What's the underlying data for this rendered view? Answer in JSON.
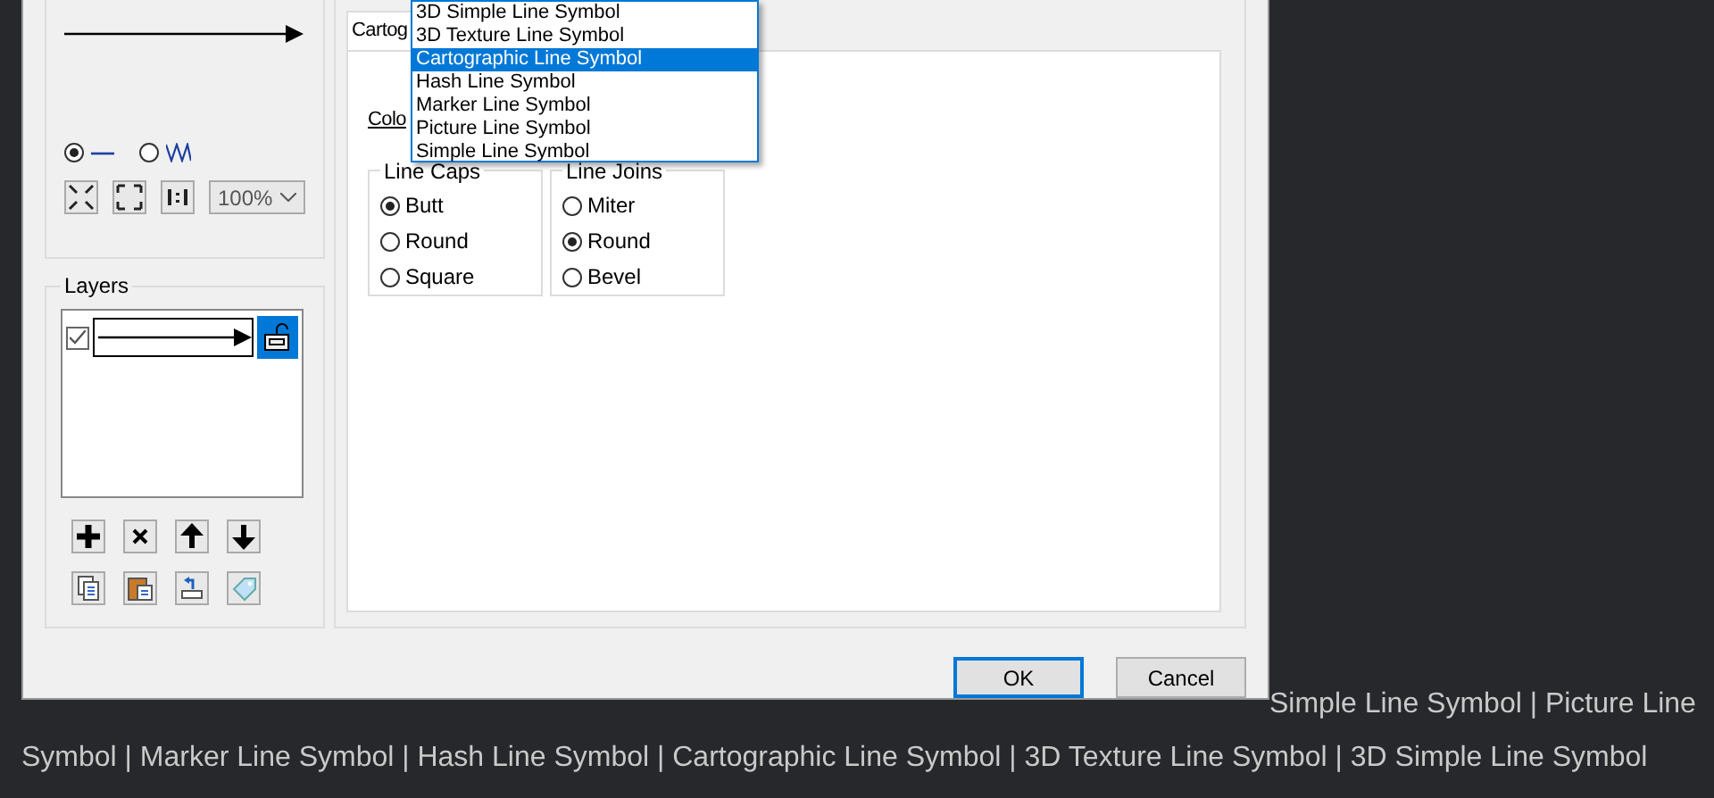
{
  "dialog": {
    "preview_modes": [
      {
        "kind": "line",
        "selected": true
      },
      {
        "kind": "zigzag",
        "selected": false
      }
    ],
    "zoom": "100%",
    "layers_title": "Layers",
    "layers": [
      {
        "visible": true,
        "selected": true
      }
    ],
    "tab": "Cartog",
    "color_label": "Colo",
    "symbol_types": [
      {
        "label": "3D Simple Line Symbol",
        "selected": false
      },
      {
        "label": "3D Texture Line Symbol",
        "selected": false
      },
      {
        "label": "Cartographic Line Symbol",
        "selected": true
      },
      {
        "label": "Hash Line Symbol",
        "selected": false
      },
      {
        "label": "Marker Line Symbol",
        "selected": false
      },
      {
        "label": "Picture Line Symbol",
        "selected": false
      },
      {
        "label": "Simple Line Symbol",
        "selected": false
      }
    ],
    "option_groups": [
      {
        "title": "Line Caps",
        "options": [
          {
            "label": "Butt",
            "selected": true
          },
          {
            "label": "Round",
            "selected": false
          },
          {
            "label": "Square",
            "selected": false
          }
        ]
      },
      {
        "title": "Line Joins",
        "options": [
          {
            "label": "Miter",
            "selected": false
          },
          {
            "label": "Round",
            "selected": true
          },
          {
            "label": "Bevel",
            "selected": false
          }
        ]
      }
    ],
    "buttons": [
      {
        "label": "OK",
        "default": true
      },
      {
        "label": "Cancel",
        "default": false
      }
    ]
  },
  "caption": {
    "line_1": "Simple Line Symbol | Picture Line",
    "line_2": "Symbol | Marker Line Symbol | Hash Line Symbol | Cartographic Line Symbol | 3D Texture Line Symbol | 3D Simple Line Symbol"
  }
}
